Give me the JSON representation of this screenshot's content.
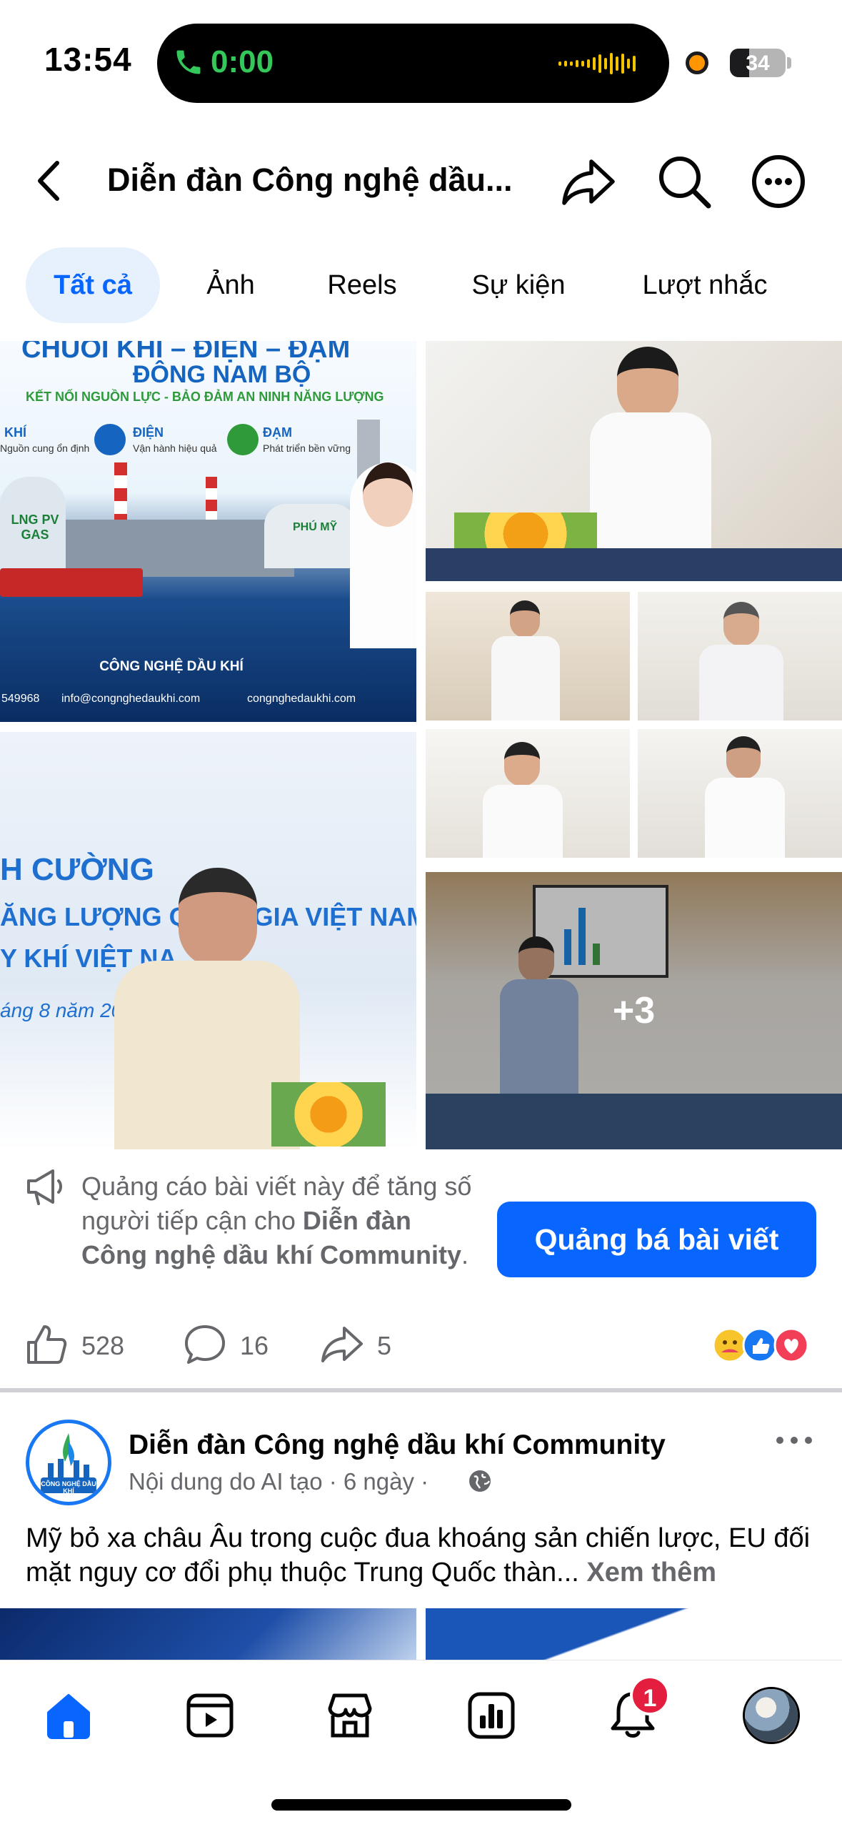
{
  "status_bar": {
    "time": "13:54",
    "call_timer": "0:00",
    "battery": "34",
    "battery_level_percent": 34
  },
  "header": {
    "title": "Diễn đàn Công nghệ dầu...",
    "icons": [
      "back-icon",
      "share-icon",
      "search-icon",
      "more-icon"
    ]
  },
  "tabs": [
    {
      "label": "Tất cả",
      "active": true
    },
    {
      "label": "Ảnh",
      "active": false
    },
    {
      "label": "Reels",
      "active": false
    },
    {
      "label": "Sự kiện",
      "active": false
    },
    {
      "label": "Lượt nhắc",
      "active": false
    }
  ],
  "ad_banner": {
    "heading_partial": "CHUỖI KHÍ – ĐIỆN – ĐẠM",
    "subheading": "ĐÔNG NAM BỘ",
    "tagline": "KẾT NỐI NGUỒN LỰC - BẢO ĐẢM AN NINH NĂNG LƯỢNG",
    "pillars": [
      {
        "title": "KHÍ",
        "desc": "Nguồn cung ổn định"
      },
      {
        "title": "ĐIỆN",
        "desc": "Vận hành hiệu quả"
      },
      {
        "title": "ĐẠM",
        "desc": "Phát triển bền vững"
      }
    ],
    "tank_label": "LNG PV GAS",
    "plant_label": "PHÚ MỸ",
    "org": "CÔNG NGHỆ DẦU KHÍ",
    "phone_partial": "549968",
    "email": "info@congnghedaukhi.com",
    "website": "congnghedaukhi.com"
  },
  "event_banner": {
    "line1": "H CƯỜNG",
    "line2": "ĂNG LƯỢNG QUỐC GIA VIỆT NAM",
    "line3": "Y KHÍ VIỆT NA",
    "line4": "áng 8 năm 20"
  },
  "more_photos": "+3",
  "promote": {
    "text_before": "Quảng cáo bài viết này để tăng số người tiếp cận cho ",
    "text_bold": "Diễn đàn Công nghệ dầu khí Community",
    "text_after": ".",
    "button": "Quảng bá bài viết"
  },
  "actions": {
    "likes": "528",
    "comments": "16",
    "shares": "5",
    "reactions": [
      "care",
      "like",
      "love"
    ]
  },
  "post2": {
    "author": "Diễn đàn Công nghệ dầu khí Community",
    "meta": "Nội dung do AI tạo · 6 ngày ·",
    "logo_text": "CÔNG NGHỆ DẦU KHÍ",
    "text": "Mỹ bỏ xa châu Âu trong cuộc đua khoáng sản chiến lược, EU đối mặt nguy cơ đổi phụ thuộc Trung Quốc thàn...",
    "see_more": "Xem thêm"
  },
  "bottom_nav": {
    "items": [
      "home-icon",
      "video-icon",
      "marketplace-icon",
      "dashboard-icon",
      "notifications-icon",
      "profile-avatar"
    ],
    "notification_badge": "1"
  },
  "colors": {
    "accent": "#0866ff",
    "tab_active_bg": "#e6f1fd",
    "secondary_text": "#65676b",
    "badge": "#e41e3f",
    "call_green": "#34c759"
  }
}
